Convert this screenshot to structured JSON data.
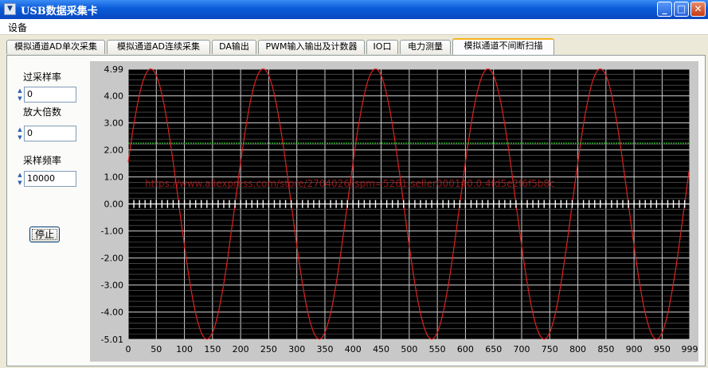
{
  "window": {
    "icon": "app-menu-icon",
    "title": "USB数据采集卡",
    "buttons": {
      "minimize": "_",
      "maximize": "□",
      "close": "✕"
    }
  },
  "menu": {
    "items": [
      {
        "label": "设备"
      }
    ]
  },
  "tabs": [
    {
      "label": "模拟通道AD单次采集",
      "active": false
    },
    {
      "label": "模拟通道AD连续采集",
      "active": false
    },
    {
      "label": "DA输出",
      "active": false
    },
    {
      "label": "PWM输入输出及计数器",
      "active": false
    },
    {
      "label": "IO口",
      "active": false
    },
    {
      "label": "电力测量",
      "active": false
    },
    {
      "label": "模拟通道不间断扫描",
      "active": true
    }
  ],
  "controls": {
    "oversample_label": "过采样率",
    "oversample_value": "0",
    "gain_label": "放大倍数",
    "gain_value": "0",
    "rate_label": "采样频率",
    "rate_value": "10000",
    "stop_label": "停止"
  },
  "watermark": "https://www.aliexpress.com/store/2704026?spm=5261.seller000140.0.4fd5e2f6f5b8c",
  "chart_data": {
    "type": "line",
    "xlim": [
      0,
      999
    ],
    "ylim": [
      -5.01,
      4.99
    ],
    "x_ticks": [
      0,
      50,
      100,
      150,
      200,
      250,
      300,
      350,
      400,
      450,
      500,
      550,
      600,
      650,
      700,
      750,
      800,
      850,
      900,
      950,
      999
    ],
    "y_ticks": [
      "4.99",
      "4.00",
      "3.00",
      "2.00",
      "1.00",
      "0.00",
      "-1.00",
      "-2.00",
      "-3.00",
      "-4.00",
      "-5.01"
    ],
    "grid": true,
    "background": "#000000",
    "grid_color": "#d0d0d0",
    "series": [
      {
        "color": "#e02020",
        "shape": "sine",
        "amplitude": 5.0,
        "offset": 0.0,
        "period": 200,
        "peak_at_x": 40
      },
      {
        "color": "#3cc83c",
        "shape": "flat",
        "value": 2.25
      },
      {
        "color": "#ffffff",
        "shape": "flat",
        "value": 0.0
      }
    ]
  }
}
